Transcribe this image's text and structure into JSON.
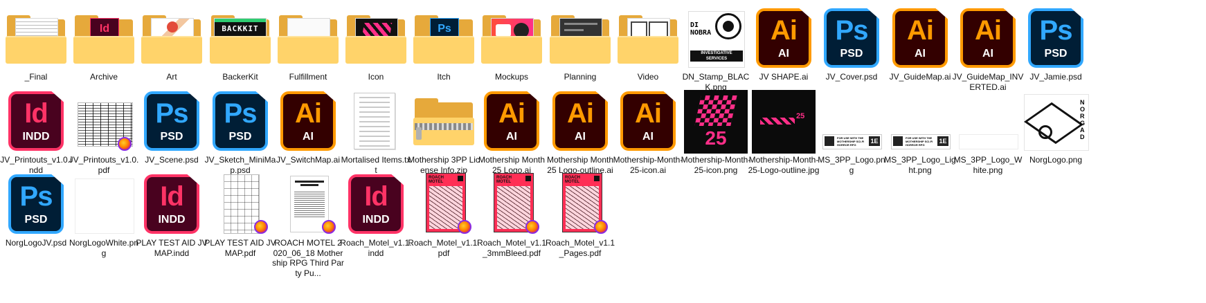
{
  "window": {
    "view": "Large icons file grid"
  },
  "icons": {
    "folder": "folder-icon",
    "ai": "adobe-illustrator-icon",
    "ps": "adobe-photoshop-icon",
    "id": "adobe-indesign-icon",
    "firefox_badge": "firefox-badge-icon"
  },
  "colors": {
    "ai_fg": "#FF9A00",
    "ai_bg": "#330000",
    "ps_fg": "#31A8FF",
    "ps_bg": "#001E36",
    "id_fg": "#FF3366",
    "id_bg": "#49021F",
    "folder": "#FFD36A",
    "mothership_pink": "#FF2E88"
  },
  "app_badges": {
    "ai": {
      "big": "Ai",
      "ext": "AI"
    },
    "ps": {
      "big": "Ps",
      "ext": "PSD"
    },
    "id": {
      "big": "Id",
      "ext": "INDD"
    }
  },
  "thumb_text": {
    "backerkit": "BACKKIT",
    "itch": "Ps",
    "mothership_num": "25",
    "ms3pp_tag": "1E",
    "ms3pp_lines": "FOR USE WITH THE MOTHERSHIP SCI-FI HORROR RPG",
    "dn_top": "DI NOBRA",
    "dn_bottom": "INVESTIGATIVE SERVICES",
    "norg_side": "NORGAD",
    "roach_title": "ROACH MOTEL"
  },
  "files": [
    {
      "name": "_Final",
      "kind": "folder",
      "thumb": "doc"
    },
    {
      "name": "Archive",
      "kind": "folder",
      "thumb": "id"
    },
    {
      "name": "Art",
      "kind": "folder",
      "thumb": "art"
    },
    {
      "name": "BackerKit",
      "kind": "folder",
      "thumb": "backerkit"
    },
    {
      "name": "Fulfillment",
      "kind": "folder",
      "thumb": "paper"
    },
    {
      "name": "Icon",
      "kind": "folder",
      "thumb": "pink"
    },
    {
      "name": "Itch",
      "kind": "folder",
      "thumb": "ps"
    },
    {
      "name": "Mockups",
      "kind": "folder",
      "thumb": "mock"
    },
    {
      "name": "Planning",
      "kind": "folder",
      "thumb": "dark"
    },
    {
      "name": "Video",
      "kind": "folder",
      "thumb": "video"
    },
    {
      "name": "DN_Stamp_BLACK.png",
      "kind": "png_stamp"
    },
    {
      "name": "JV SHAPE.ai",
      "kind": "ai"
    },
    {
      "name": "JV_Cover.psd",
      "kind": "ps"
    },
    {
      "name": "JV_GuideMap.ai",
      "kind": "ai"
    },
    {
      "name": "JV_GuideMap_INVERTED.ai",
      "kind": "ai"
    },
    {
      "name": "JV_Jamie.psd",
      "kind": "ps"
    },
    {
      "name": "JV_Printouts_v1.0.indd",
      "kind": "id"
    },
    {
      "name": "JV_Printouts_v1.0.pdf",
      "kind": "pdf_doc"
    },
    {
      "name": "JV_Scene.psd",
      "kind": "ps"
    },
    {
      "name": "JV_Sketch_MiniMap.psd",
      "kind": "ps"
    },
    {
      "name": "JV_SwitchMap.ai",
      "kind": "ai"
    },
    {
      "name": "Mortalised Items.txt",
      "kind": "txt"
    },
    {
      "name": "Mothership 3PP License Info.zip",
      "kind": "zip"
    },
    {
      "name": "Mothership Month 25 Logo.ai",
      "kind": "ai"
    },
    {
      "name": "Mothership Month 25 Logo-outline.ai",
      "kind": "ai"
    },
    {
      "name": "Mothership-Month-25-icon.ai",
      "kind": "ai"
    },
    {
      "name": "Mothership-Month-25-icon.png",
      "kind": "ms_icon"
    },
    {
      "name": "Mothership-Month-25-Logo-outline.jpg",
      "kind": "ms_logo"
    },
    {
      "name": "MS_3PP_Logo.png",
      "kind": "ms3pp"
    },
    {
      "name": "MS_3PP_Logo_Light.png",
      "kind": "ms3pp"
    },
    {
      "name": "MS_3PP_Logo_White.png",
      "kind": "blank"
    },
    {
      "name": "NorgLogo.png",
      "kind": "norg"
    },
    {
      "name": "NorgLogoJV.psd",
      "kind": "ps"
    },
    {
      "name": "NorgLogoWhite.png",
      "kind": "blank"
    },
    {
      "name": "PLAY TEST AID JV MAP.indd",
      "kind": "id"
    },
    {
      "name": "PLAY TEST AID JV MAP.pdf",
      "kind": "pdf_map"
    },
    {
      "name": "ROACH MOTEL 2020_06_18 Mothership RPG Third Party Pu...",
      "kind": "pdf_text"
    },
    {
      "name": "Roach_Motel_v1.1.indd",
      "kind": "id"
    },
    {
      "name": "Roach_Motel_v1.1.pdf",
      "kind": "roach"
    },
    {
      "name": "Roach_Motel_v1.1_3mmBleed.pdf",
      "kind": "roach"
    },
    {
      "name": "Roach_Motel_v1.1_Pages.pdf",
      "kind": "roach"
    }
  ]
}
